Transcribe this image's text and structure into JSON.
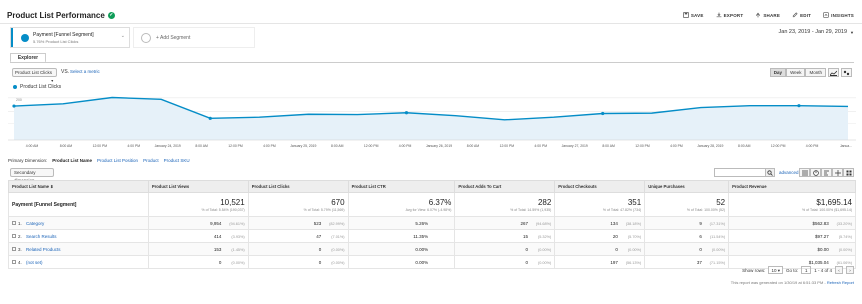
{
  "header": {
    "title": "Product List Performance",
    "toolbar": [
      {
        "label": "SAVE",
        "icon": "save-icon"
      },
      {
        "label": "EXPORT",
        "icon": "export-icon"
      },
      {
        "label": "SHARE",
        "icon": "share-icon"
      },
      {
        "label": "EDIT",
        "icon": "edit-icon"
      },
      {
        "label": "INSIGHTS",
        "icon": "insights-icon"
      }
    ]
  },
  "segments": {
    "active_name": "Payment [Funnel Segment]",
    "active_sub": "5.76% Product List Clicks",
    "add_label": "+ Add Segment"
  },
  "date_range": "Jan 23, 2019 - Jan 29, 2019",
  "tabs": {
    "explorer": "Explorer"
  },
  "metric_controls": {
    "metric": "Product List Clicks",
    "vs": "VS.",
    "select_metric": "Select a metric",
    "periods": [
      "Day",
      "Week",
      "Month"
    ],
    "active_period": "Day"
  },
  "chart_data": {
    "type": "line",
    "series": [
      {
        "name": "Product List Clicks",
        "color": "#058dc7",
        "values": [
          102,
          108,
          125,
          120,
          69,
          72,
          80,
          79,
          84,
          76,
          65,
          72,
          82,
          83,
          98,
          103,
          103,
          101
        ]
      }
    ],
    "ylim": [
      0,
      200
    ],
    "yticks": [
      "200",
      "100",
      "50"
    ],
    "xticks": [
      [
        "4:00 AM",
        "8:00 AM",
        "12:00 PM",
        "4:00 PM",
        "January 24, 2019",
        "8:00 AM",
        "12:00 PM",
        "4:00 PM"
      ],
      [
        "January 25, 2019",
        "8:00 AM",
        "12:00 PM",
        "4:00 PM",
        "January 26, 2019",
        "8:00 AM",
        "12:00 PM",
        "4:00 PM"
      ],
      [
        "January 27, 2019",
        "8:00 AM",
        "12:00 PM",
        "4:00 PM",
        "January 28, 2019",
        "8:00 AM",
        "12:00 PM",
        "4:00 PM",
        "Janua..."
      ]
    ],
    "grid": true,
    "legend": "top-left"
  },
  "dimensions": {
    "label": "Primary Dimension:",
    "items": [
      "Product List Name",
      "Product List Position",
      "Product",
      "Product SKU"
    ],
    "active": "Product List Name",
    "secondary": "Secondary dimension",
    "advanced": "advanced"
  },
  "table": {
    "columns": [
      "Product List Name",
      "Product List Views",
      "Product List Clicks",
      "Product List CTR",
      "Product Adds To Cart",
      "Product Checkouts",
      "Unique Purchases",
      "Product Revenue"
    ],
    "total": {
      "label": "Payment [Funnel Segment]",
      "values": [
        "10,521",
        "670",
        "6.37%",
        "282",
        "351",
        "52",
        "$1,695.14"
      ],
      "subs": [
        "% of Total: 5.54% (190,037)",
        "% of Total: 5.79% (11,569)",
        "Avg for View: 6.07% (-4.98%)",
        "% of Total: 14.59% (1,935)",
        "% of Total: 47.82% (734)",
        "% of Total: 100.00% (52)",
        "% of Total: 100.00% ($1,695.14)"
      ]
    },
    "rows": [
      {
        "num": "1.",
        "name": "Category",
        "cells": [
          [
            "9,954",
            "(94.61%)"
          ],
          [
            "523",
            "(82.99%)"
          ],
          [
            "5.26%",
            ""
          ],
          [
            "267",
            "(94.68%)"
          ],
          [
            "134",
            "(38.18%)"
          ],
          [
            "9",
            "(17.31%)"
          ],
          [
            "$562.83",
            "(33.20%)"
          ]
        ]
      },
      {
        "num": "2.",
        "name": "Search Results",
        "cells": [
          [
            "414",
            "(3.93%)"
          ],
          [
            "47",
            "(7.01%)"
          ],
          [
            "11.35%",
            ""
          ],
          [
            "15",
            "(5.32%)"
          ],
          [
            "20",
            "(5.70%)"
          ],
          [
            "6",
            "(11.54%)"
          ],
          [
            "$97.27",
            "(5.74%)"
          ]
        ]
      },
      {
        "num": "3.",
        "name": "Related Products",
        "cells": [
          [
            "153",
            "(1.45%)"
          ],
          [
            "0",
            "(0.00%)"
          ],
          [
            "0.00%",
            ""
          ],
          [
            "0",
            "(0.00%)"
          ],
          [
            "0",
            "(0.00%)"
          ],
          [
            "0",
            "(0.00%)"
          ],
          [
            "$0.00",
            "(0.00%)"
          ]
        ]
      },
      {
        "num": "4.",
        "name": "(not set)",
        "cells": [
          [
            "0",
            "(0.00%)"
          ],
          [
            "0",
            "(0.00%)"
          ],
          [
            "0.00%",
            ""
          ],
          [
            "0",
            "(0.00%)"
          ],
          [
            "197",
            "(56.13%)"
          ],
          [
            "37",
            "(71.15%)"
          ],
          [
            "$1,035.04",
            "(61.06%)"
          ]
        ]
      }
    ]
  },
  "pager": {
    "show_rows": "Show rows:",
    "rows_value": "10",
    "goto": "Go to:",
    "goto_value": "1",
    "range": "1 - 4 of 4"
  },
  "footer_note": {
    "text": "This report was generated on 1/30/19 at 6:51:33 PM -",
    "link": "Refresh Report"
  }
}
